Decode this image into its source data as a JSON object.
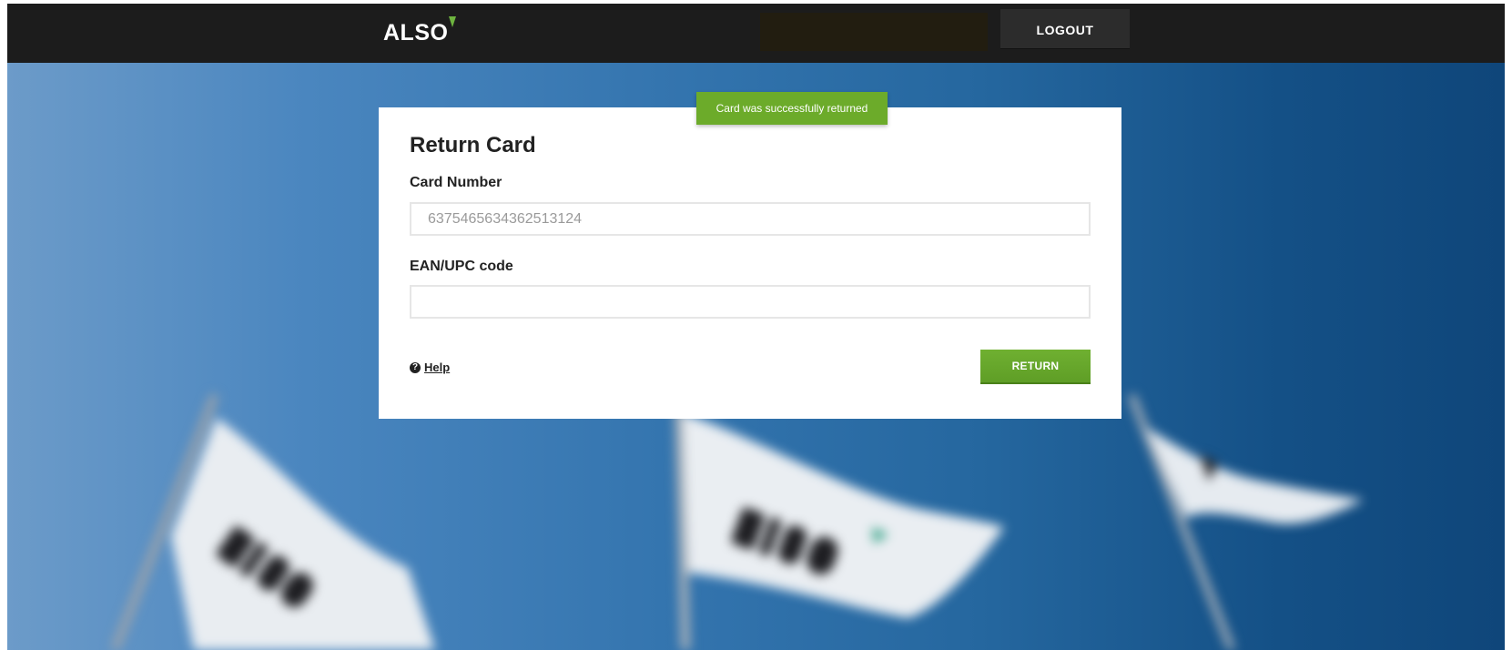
{
  "header": {
    "logo_text": "ALSO",
    "logout_label": "LOGOUT"
  },
  "notification": {
    "message": "Card was successfully returned"
  },
  "form": {
    "title": "Return Card",
    "card_number_label": "Card Number",
    "card_number_value": "6375465634362513124",
    "ean_label": "EAN/UPC code",
    "ean_value": "",
    "help_icon_glyph": "?",
    "help_label": "Help",
    "submit_label": "RETURN"
  },
  "colors": {
    "header_bg": "#1c1c1c",
    "accent_green": "#6cab2a",
    "logo_mark": "#6eb43f"
  },
  "icons": {
    "help": "question-circle-icon",
    "logo_mark": "triangle-logo-icon"
  }
}
